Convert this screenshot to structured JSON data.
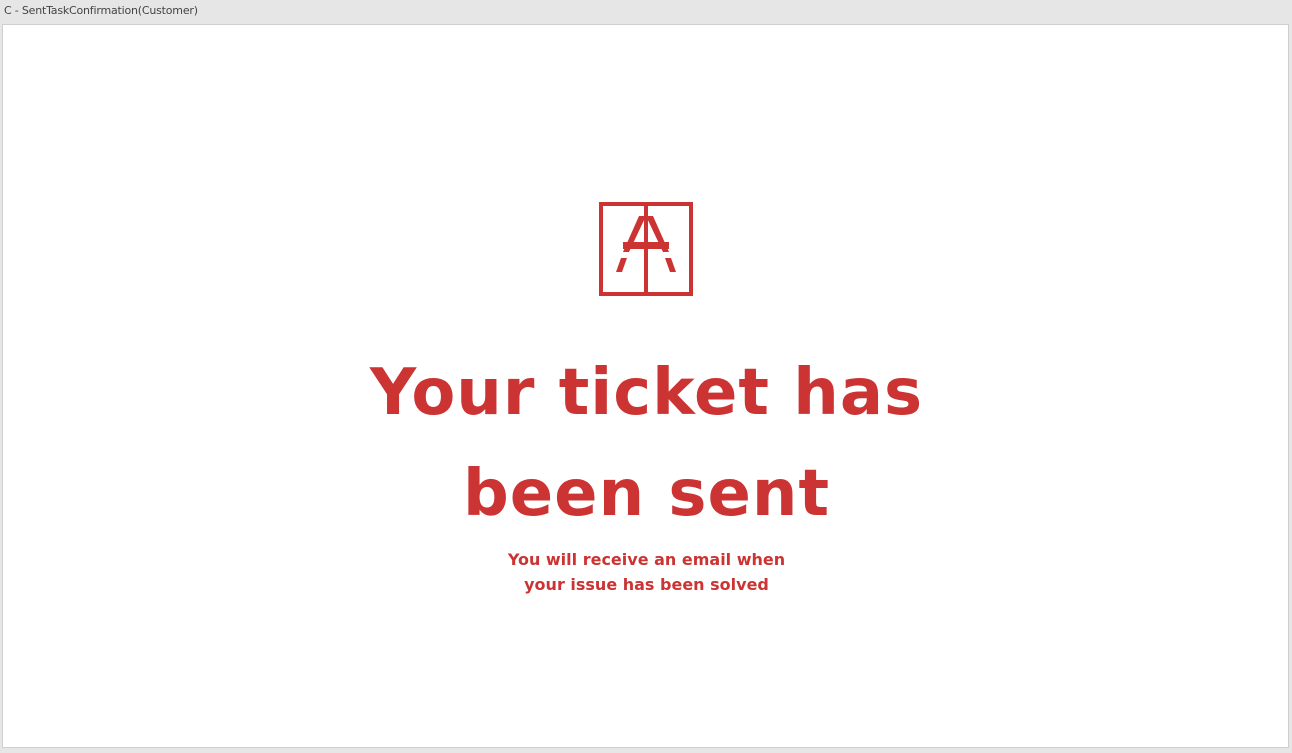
{
  "window": {
    "title": "C - SentTaskConfirmation(Customer)"
  },
  "confirmation": {
    "logo_icon": "company-logo-icon",
    "headline_line1": "Your ticket has",
    "headline_line2": "been sent",
    "message_line1": "You will receive an email when",
    "message_line2": "your issue has been solved"
  },
  "colors": {
    "accent": "#cc3333",
    "background": "#ffffff",
    "chrome": "#e6e6e6"
  }
}
